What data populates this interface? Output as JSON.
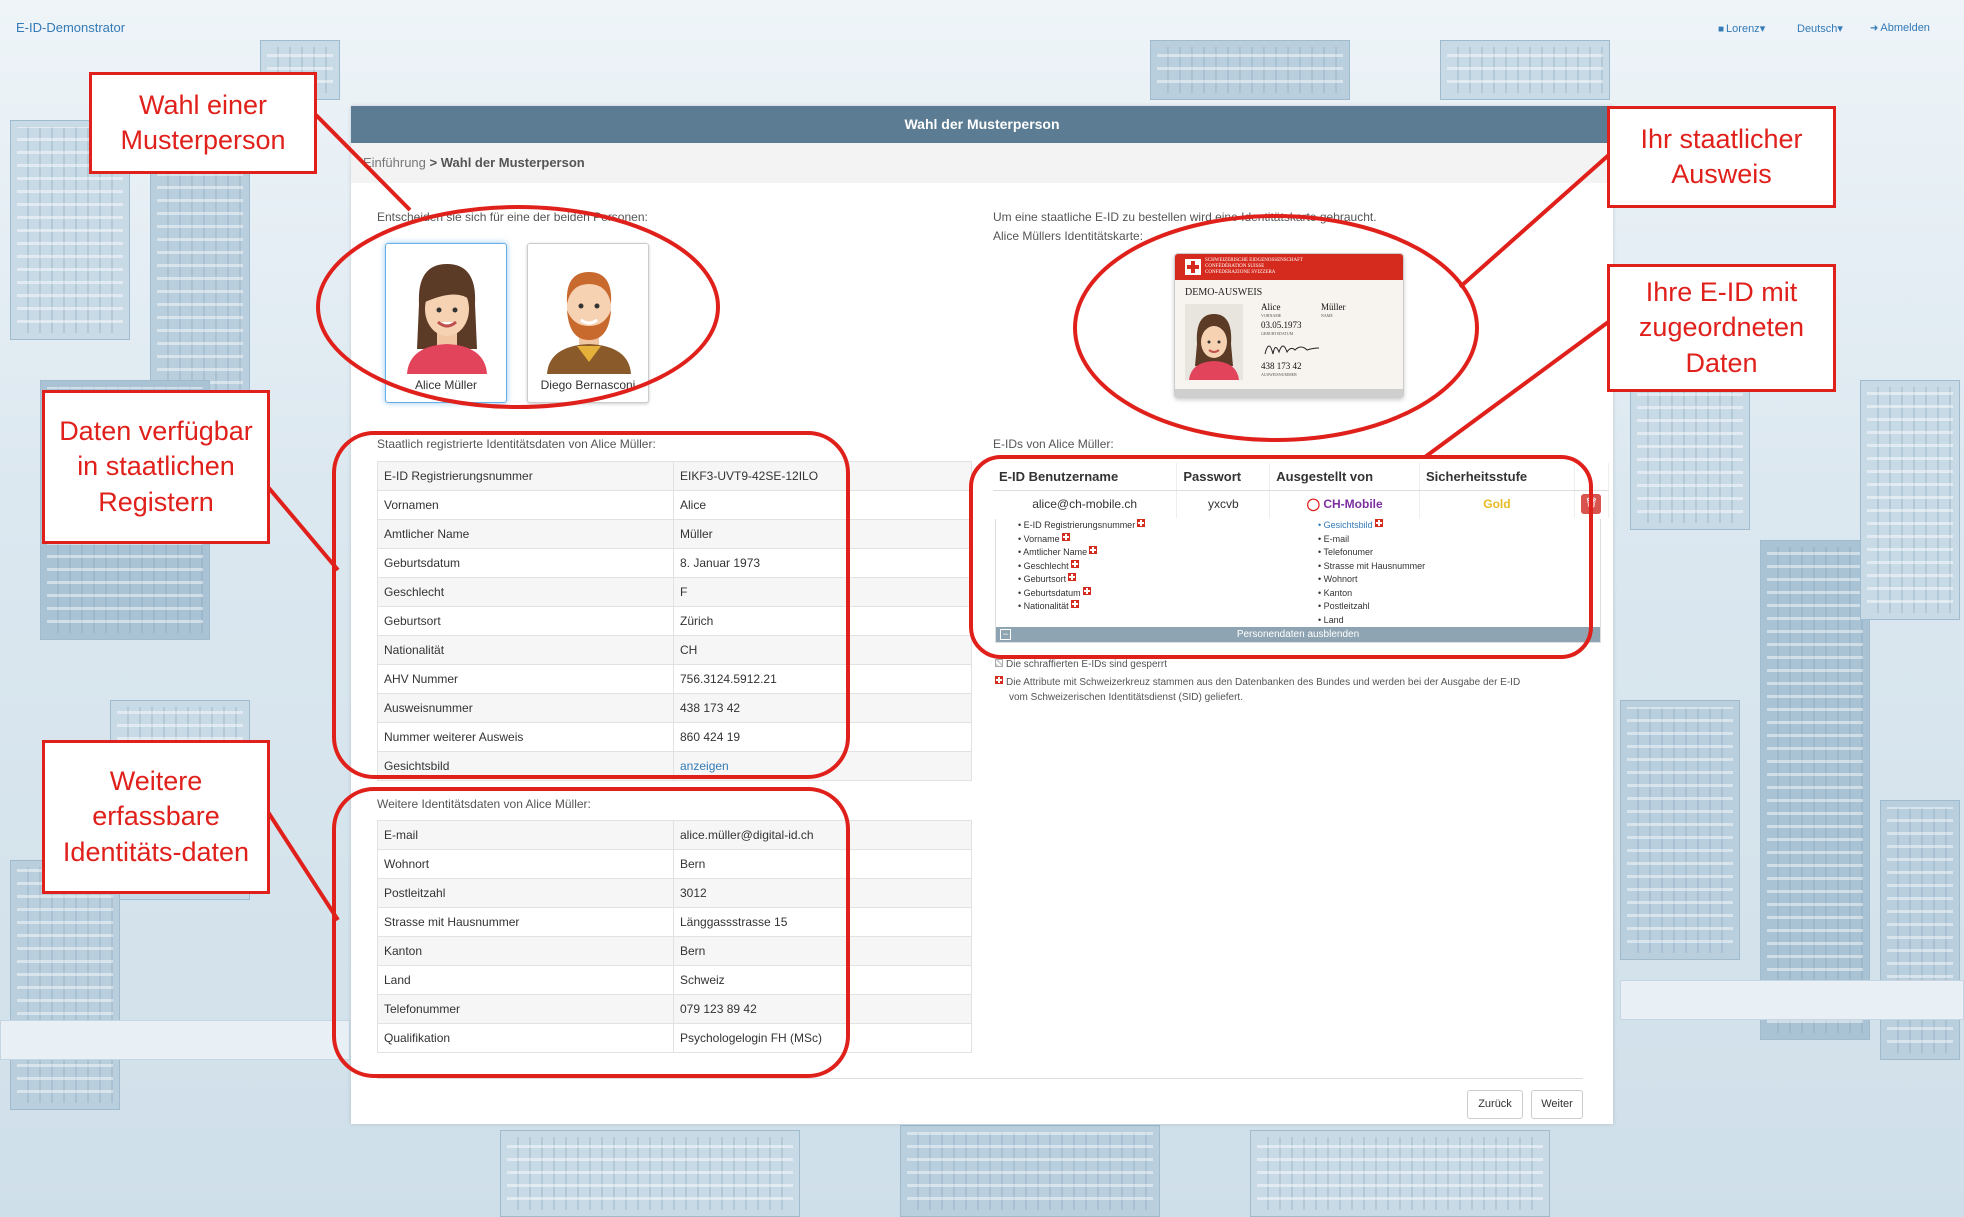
{
  "nav": {
    "brand": "E-ID-Demonstrator",
    "user": "Lorenz",
    "language": "Deutsch",
    "logout": "Abmelden"
  },
  "panel": {
    "title": "Wahl der Musterperson",
    "breadcrumb_prev": "Einführung",
    "breadcrumb_sep": ">",
    "breadcrumb_current": "Wahl der Musterperson"
  },
  "choose_prompt": "Entscheiden sie sich für eine der beiden Personen:",
  "persons": [
    {
      "name": "Alice Müller"
    },
    {
      "name": "Diego Bernasconi"
    }
  ],
  "id_info": {
    "line1": "Um eine staatliche E-ID zu bestellen wird eine Identitätskarte gebraucht.",
    "line2": "Alice Müllers Identitätskarte:"
  },
  "idcard": {
    "header1": "SCHWEIZERISCHE EIDGENOSSENSCHAFT",
    "header2": "CONFÉDÉRATION SUISSE",
    "header3": "CONFEDERAZIONE SVIZZERA",
    "title": "DEMO-AUSWEIS",
    "given": "Alice",
    "given_label": "VORNAME",
    "surname": "Müller",
    "surname_label": "NAME",
    "dob": "03.05.1973",
    "dob_label": "GEBURTSDATUM",
    "number": "438 173 42",
    "number_label": "AUSWEISNUMMER"
  },
  "state_data": {
    "heading": "Staatlich registrierte Identitätsdaten von Alice Müller:",
    "rows": [
      [
        "E-ID Registrierungsnummer",
        "EIKF3-UVT9-42SE-12ILO"
      ],
      [
        "Vornamen",
        "Alice"
      ],
      [
        "Amtlicher Name",
        "Müller"
      ],
      [
        "Geburtsdatum",
        "8. Januar 1973"
      ],
      [
        "Geschlecht",
        "F"
      ],
      [
        "Geburtsort",
        "Zürich"
      ],
      [
        "Nationalität",
        "CH"
      ],
      [
        "AHV Nummer",
        "756.3124.5912.21"
      ],
      [
        "Ausweisnummer",
        "438 173 42"
      ],
      [
        "Nummer weiterer Ausweis",
        "860 424 19"
      ],
      [
        "Gesichtsbild",
        "anzeigen"
      ]
    ]
  },
  "other_data": {
    "heading": "Weitere Identitätsdaten von Alice Müller:",
    "rows": [
      [
        "E-mail",
        "alice.müller@digital-id.ch"
      ],
      [
        "Wohnort",
        "Bern"
      ],
      [
        "Postleitzahl",
        "3012"
      ],
      [
        "Strasse mit Hausnummer",
        "Länggassstrasse 15"
      ],
      [
        "Kanton",
        "Bern"
      ],
      [
        "Land",
        "Schweiz"
      ],
      [
        "Telefonummer",
        "079 123 89 42"
      ],
      [
        "Qualifikation",
        "Psychologelogin FH (MSc)"
      ]
    ]
  },
  "eids": {
    "heading": "E-IDs von Alice Müller:",
    "columns": [
      "E-ID Benutzername",
      "Passwort",
      "Ausgestellt von",
      "Sicherheitsstufe"
    ],
    "row": {
      "username": "alice@ch-mobile.ch",
      "password": "yxcvb",
      "issuer": "CH-Mobile",
      "level": "Gold"
    },
    "attrs_left": [
      "E-ID Registrierungsnummer",
      "Vorname",
      "Amtlicher Name",
      "Geschlecht",
      "Geburtsort",
      "Geburtsdatum",
      "Nationalität"
    ],
    "attrs_right": [
      "Gesichtsbild",
      "E-mail",
      "Telefonumer",
      "Strasse mit Hausnummer",
      "Wohnort",
      "Kanton",
      "Postleitzahl",
      "Land"
    ],
    "hide_label": "Personendaten ausblenden",
    "note1": "Die schraffierten E-IDs sind gesperrt",
    "note2a": "Die Attribute mit Schweizerkreuz stammen aus den Datenbanken des Bundes und werden bei der Ausgabe der E-ID",
    "note2b": "vom Schweizerischen Identitätsdienst (SID) geliefert."
  },
  "buttons": {
    "back": "Zurück",
    "next": "Weiter"
  },
  "annotations": {
    "a1": "Wahl einer Musterperson",
    "a2": "Daten verfügbar in staatlichen Registern",
    "a3": "Weitere erfassbare Identitäts-daten",
    "a4": "Ihr staatlicher Ausweis",
    "a5": "Ihre E-ID mit zugeordneten Daten"
  },
  "colors": {
    "annotation": "#e0201b",
    "header": "#5b7c93",
    "link": "#337ab7",
    "gold": "#e8b923",
    "issuer": "#7b2fa0"
  }
}
